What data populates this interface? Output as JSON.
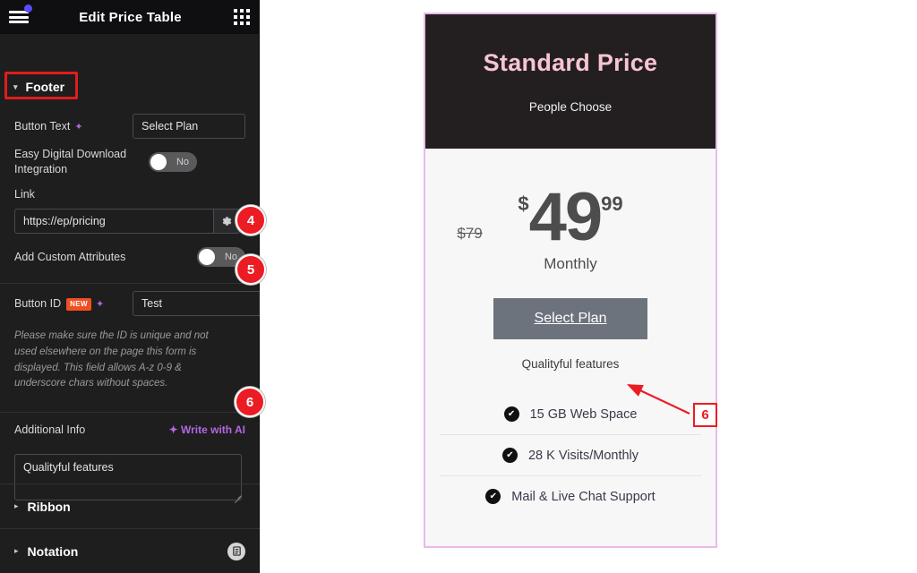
{
  "panel": {
    "title": "Edit Price Table",
    "menu_icon": "hamburger-menu-icon",
    "grid_icon": "apps-grid-icon",
    "section_footer": {
      "label": "Footer",
      "caret": "▾"
    },
    "fields": {
      "button_text": {
        "label": "Button Text",
        "sparkle": "✦",
        "value": "Select Plan"
      },
      "edd_integration": {
        "label": "Easy Digital Download Integration",
        "toggle_value": "No"
      },
      "link": {
        "label": "Link",
        "value": "https://ep/pricing",
        "suffix_icon": "gear-icon"
      },
      "custom_attributes": {
        "label": "Add Custom Attributes",
        "toggle_value": "No"
      },
      "button_id": {
        "label": "Button ID",
        "new_badge": "NEW",
        "sparkle": "✦",
        "value": "Test",
        "suffix_icon": "database-stack-icon",
        "help": "Please make sure the ID is unique and not used elsewhere on the page this form is displayed. This field allows A‐z  0‐9 & underscore chars without spaces."
      },
      "additional_info": {
        "label": "Additional Info",
        "write_with_ai": "✦ Write with AI",
        "value": "Qualityful features"
      }
    },
    "sections_bottom": [
      {
        "label": "Ribbon",
        "caret": "▸",
        "icon": null
      },
      {
        "label": "Notation",
        "caret": "▸",
        "icon": "notation-doc-icon"
      }
    ],
    "collapse_handle": "‹"
  },
  "preview_card": {
    "title": "Standard Price",
    "subtitle": "People Choose",
    "price": {
      "old": "$79",
      "currency": "$",
      "amount": "49",
      "decimals": "99",
      "period": "Monthly"
    },
    "button_label": "Select Plan",
    "additional_info": "Qualityful features",
    "features": [
      {
        "check": "✔",
        "text": "15 GB Web Space"
      },
      {
        "check": "✔",
        "text": "28 K Visits/Monthly"
      },
      {
        "check": "✔",
        "text": "Mail & Live Chat Support"
      }
    ]
  },
  "annotations": {
    "marker_4": "4",
    "marker_5": "5",
    "marker_6_circle": "6",
    "marker_6_square": "6"
  },
  "colors": {
    "annotation_red": "#ec1c24",
    "panel_bg": "#1e1e1f",
    "card_border_pink": "#ecb9e8",
    "card_title_pink": "#f7c5d2",
    "ai_purple": "#b267e0",
    "new_badge_orange": "#f04f23",
    "button_gray": "#6d737d"
  }
}
